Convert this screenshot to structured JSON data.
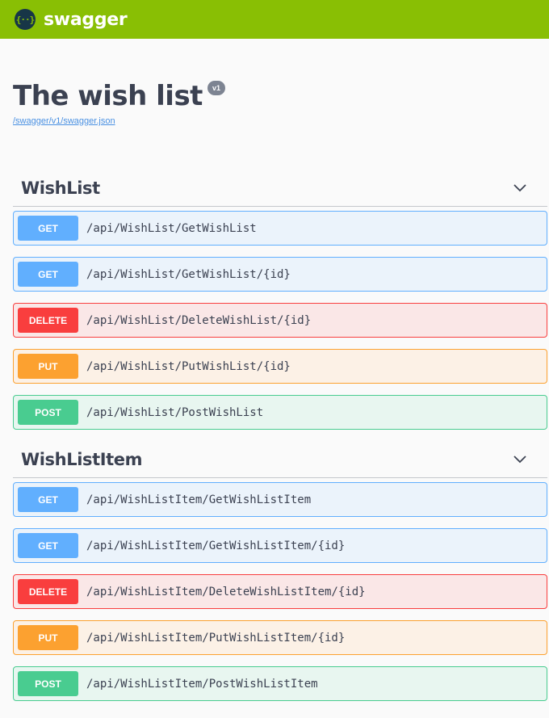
{
  "topbar": {
    "logo_glyph": "{··}",
    "brand": "swagger",
    "color": "#89bf04"
  },
  "info": {
    "title": "The wish list",
    "version": "v1",
    "spec_url": "/swagger/v1/swagger.json"
  },
  "tags": [
    {
      "name": "WishList",
      "operations": [
        {
          "method": "GET",
          "path": "/api/WishList/GetWishList"
        },
        {
          "method": "GET",
          "path": "/api/WishList/GetWishList/{id}"
        },
        {
          "method": "DELETE",
          "path": "/api/WishList/DeleteWishList/{id}"
        },
        {
          "method": "PUT",
          "path": "/api/WishList/PutWishList/{id}"
        },
        {
          "method": "POST",
          "path": "/api/WishList/PostWishList"
        }
      ]
    },
    {
      "name": "WishListItem",
      "operations": [
        {
          "method": "GET",
          "path": "/api/WishListItem/GetWishListItem"
        },
        {
          "method": "GET",
          "path": "/api/WishListItem/GetWishListItem/{id}"
        },
        {
          "method": "DELETE",
          "path": "/api/WishListItem/DeleteWishListItem/{id}"
        },
        {
          "method": "PUT",
          "path": "/api/WishListItem/PutWishListItem/{id}"
        },
        {
          "method": "POST",
          "path": "/api/WishListItem/PostWishListItem"
        }
      ]
    }
  ],
  "method_colors": {
    "GET": "#61affe",
    "DELETE": "#f93e3e",
    "PUT": "#fca130",
    "POST": "#49cc90"
  }
}
